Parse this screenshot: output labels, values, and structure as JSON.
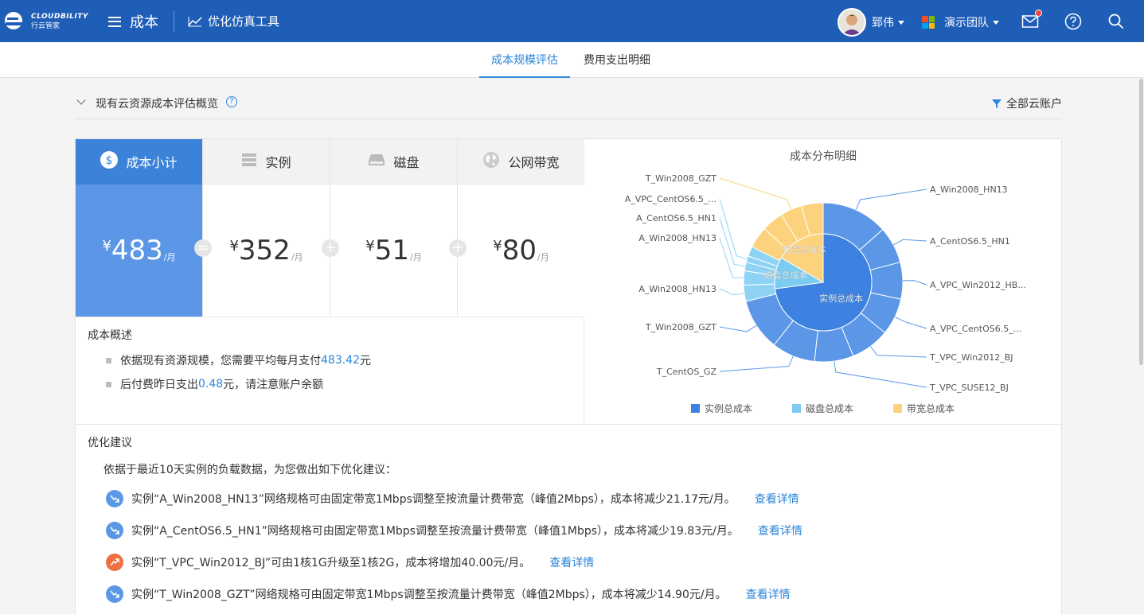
{
  "header": {
    "logo_en": "CLOUDBILITY",
    "logo_cn": "行云管家",
    "menu_label": "成本",
    "tool_label": "优化仿真工具",
    "user_name": "郅伟",
    "team_name": "演示团队"
  },
  "tabs": [
    {
      "label": "成本规模评估",
      "active": true
    },
    {
      "label": "费用支出明细",
      "active": false
    }
  ],
  "overview": {
    "title": "现有云资源成本评估概览",
    "filter_label": "全部云账户"
  },
  "cost": {
    "columns": [
      {
        "label": "成本小计",
        "yen": "¥",
        "value": "483",
        "unit": "/月"
      },
      {
        "label": "实例",
        "yen": "¥",
        "value": "352",
        "unit": "/月"
      },
      {
        "label": "磁盘",
        "yen": "¥",
        "value": "51",
        "unit": "/月"
      },
      {
        "label": "公网带宽",
        "yen": "¥",
        "value": "80",
        "unit": "/月"
      }
    ],
    "ops": [
      "=",
      "+",
      "+"
    ]
  },
  "summary": {
    "title": "成本概述",
    "line1_prefix": "依据现有资源规模，您需要平均每月支付",
    "line1_value": "483.42",
    "line1_suffix": "元",
    "line2_prefix": "后付费昨日支出",
    "line2_value": "0.48",
    "line2_suffix": "元，请注意账户余额"
  },
  "chart_data": {
    "type": "pie",
    "title": "成本分布明细",
    "inner": [
      {
        "name": "实例总成本",
        "value": 352,
        "color": "#3d82e0"
      },
      {
        "name": "磁盘总成本",
        "value": 51,
        "color": "#7ccbf0"
      },
      {
        "name": "带宽总成本",
        "value": 80,
        "color": "#fdd27c"
      }
    ],
    "outer": [
      {
        "name": "A_Win2008_HN13",
        "value": 61,
        "group": 0
      },
      {
        "name": "A_CentOS6.5_HN1",
        "value": 34,
        "group": 0
      },
      {
        "name": "A_VPC_Win2012_HB...",
        "value": 34,
        "group": 0
      },
      {
        "name": "A_VPC_CentOS6.5_...",
        "value": 34,
        "group": 0
      },
      {
        "name": "T_VPC_Win2012_BJ",
        "value": 36,
        "group": 0
      },
      {
        "name": "T_VPC_SUSE12_BJ",
        "value": 36,
        "group": 0
      },
      {
        "name": "T_CentOS_GZ",
        "value": 40,
        "group": 0
      },
      {
        "name": "T_Win2008_GZT",
        "value": 48,
        "group": 0
      },
      {
        "name": "A_Win2008_HN13",
        "value": 15,
        "group": 1
      },
      {
        "name": "A_Win2008_HN13",
        "value": 13,
        "group": 1
      },
      {
        "name": "A_CentOS6.5_HN1",
        "value": 8,
        "group": 1
      },
      {
        "name": "A_VPC_CentOS6.5_...",
        "value": 6,
        "group": 1
      },
      {
        "name": "A_VPC_CentOS6.5_...",
        "value": 9,
        "group": 1
      },
      {
        "name": "A_CentOS6.5_HN1",
        "value": 20,
        "group": 2
      },
      {
        "name": "A_VPC_CentOS6.5_...",
        "value": 20,
        "group": 2
      },
      {
        "name": "T_Win2008_GZT",
        "value": 20,
        "group": 2
      },
      {
        "name": "T_Win2008_GZT",
        "value": 20,
        "group": 2
      }
    ],
    "outer_colors": [
      "#5b97e6",
      "#8fd3f4",
      "#fdd27c"
    ],
    "labels": [
      {
        "text": "A_Win2008_HN13",
        "side": "right"
      },
      {
        "text": "A_CentOS6.5_HN1",
        "side": "right"
      },
      {
        "text": "A_VPC_Win2012_HB...",
        "side": "right"
      },
      {
        "text": "A_VPC_CentOS6.5_...",
        "side": "right"
      },
      {
        "text": "T_VPC_Win2012_BJ",
        "side": "right"
      },
      {
        "text": "T_VPC_SUSE12_BJ",
        "side": "right"
      },
      {
        "text": "T_CentOS_GZ",
        "side": "left"
      },
      {
        "text": "T_Win2008_GZT",
        "side": "left"
      },
      {
        "text": "A_Win2008_HN13",
        "side": "left"
      },
      {
        "text": "A_Win2008_HN13",
        "side": "left"
      },
      {
        "text": "A_CentOS6.5_HN1",
        "side": "left"
      },
      {
        "text": "A_VPC_CentOS6.5_...",
        "side": "left"
      },
      {
        "text": "T_Win2008_GZT",
        "side": "left"
      }
    ],
    "legend": [
      "实例总成本",
      "磁盘总成本",
      "带宽总成本"
    ],
    "legend_position": "bottom"
  },
  "optimize": {
    "title": "优化建议",
    "intro": "依据于最近10天实例的负载数据，为您做出如下优化建议：",
    "items": [
      {
        "text": "实例“A_Win2008_HN13”网络规格可由固定带宽1Mbps调整至按流量计费带宽（峰值2Mbps），成本将减少21.17元/月。",
        "link": "查看详情",
        "trend": "down"
      },
      {
        "text": "实例“A_CentOS6.5_HN1”网络规格可由固定带宽1Mbps调整至按流量计费带宽（峰值1Mbps），成本将减少19.83元/月。",
        "link": "查看详情",
        "trend": "down"
      },
      {
        "text": "实例“T_VPC_Win2012_BJ”可由1核1G升级至1核2G，成本将增加40.00元/月。",
        "link": "查看详情",
        "trend": "up"
      },
      {
        "text": "实例“T_Win2008_GZT”网络规格可由固定带宽1Mbps调整至按流量计费带宽（峰值2Mbps），成本将减少14.90元/月。",
        "link": "查看详情",
        "trend": "down"
      }
    ]
  }
}
